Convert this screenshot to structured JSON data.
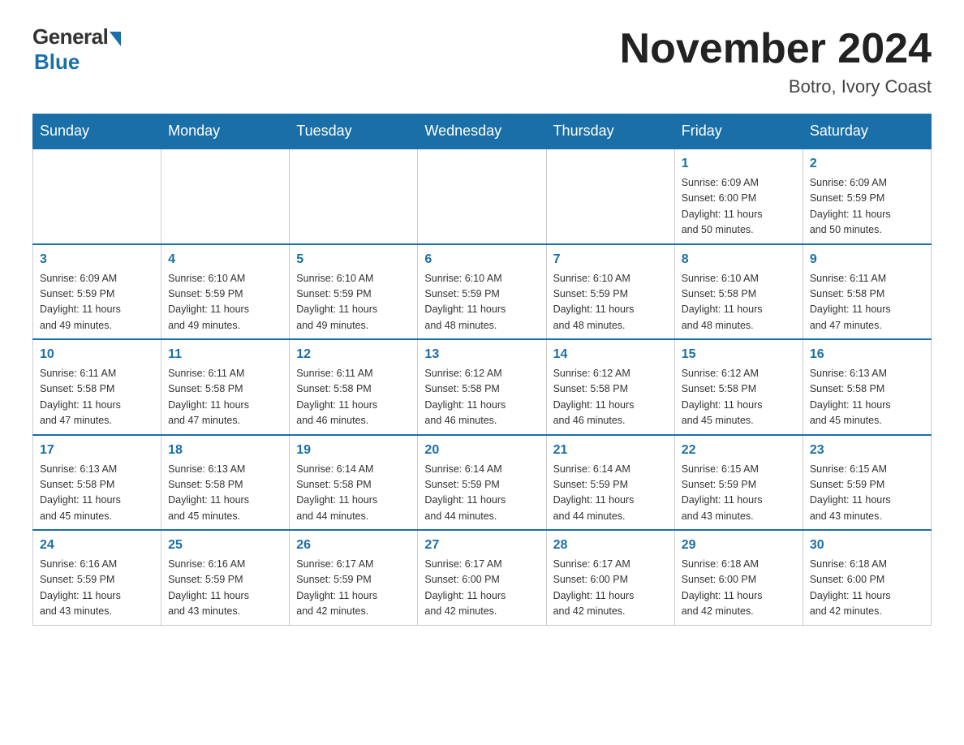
{
  "header": {
    "logo_general": "General",
    "logo_blue": "Blue",
    "month_title": "November 2024",
    "subtitle": "Botro, Ivory Coast"
  },
  "days_of_week": [
    "Sunday",
    "Monday",
    "Tuesday",
    "Wednesday",
    "Thursday",
    "Friday",
    "Saturday"
  ],
  "weeks": [
    [
      {
        "day": "",
        "info": ""
      },
      {
        "day": "",
        "info": ""
      },
      {
        "day": "",
        "info": ""
      },
      {
        "day": "",
        "info": ""
      },
      {
        "day": "",
        "info": ""
      },
      {
        "day": "1",
        "info": "Sunrise: 6:09 AM\nSunset: 6:00 PM\nDaylight: 11 hours\nand 50 minutes."
      },
      {
        "day": "2",
        "info": "Sunrise: 6:09 AM\nSunset: 5:59 PM\nDaylight: 11 hours\nand 50 minutes."
      }
    ],
    [
      {
        "day": "3",
        "info": "Sunrise: 6:09 AM\nSunset: 5:59 PM\nDaylight: 11 hours\nand 49 minutes."
      },
      {
        "day": "4",
        "info": "Sunrise: 6:10 AM\nSunset: 5:59 PM\nDaylight: 11 hours\nand 49 minutes."
      },
      {
        "day": "5",
        "info": "Sunrise: 6:10 AM\nSunset: 5:59 PM\nDaylight: 11 hours\nand 49 minutes."
      },
      {
        "day": "6",
        "info": "Sunrise: 6:10 AM\nSunset: 5:59 PM\nDaylight: 11 hours\nand 48 minutes."
      },
      {
        "day": "7",
        "info": "Sunrise: 6:10 AM\nSunset: 5:59 PM\nDaylight: 11 hours\nand 48 minutes."
      },
      {
        "day": "8",
        "info": "Sunrise: 6:10 AM\nSunset: 5:58 PM\nDaylight: 11 hours\nand 48 minutes."
      },
      {
        "day": "9",
        "info": "Sunrise: 6:11 AM\nSunset: 5:58 PM\nDaylight: 11 hours\nand 47 minutes."
      }
    ],
    [
      {
        "day": "10",
        "info": "Sunrise: 6:11 AM\nSunset: 5:58 PM\nDaylight: 11 hours\nand 47 minutes."
      },
      {
        "day": "11",
        "info": "Sunrise: 6:11 AM\nSunset: 5:58 PM\nDaylight: 11 hours\nand 47 minutes."
      },
      {
        "day": "12",
        "info": "Sunrise: 6:11 AM\nSunset: 5:58 PM\nDaylight: 11 hours\nand 46 minutes."
      },
      {
        "day": "13",
        "info": "Sunrise: 6:12 AM\nSunset: 5:58 PM\nDaylight: 11 hours\nand 46 minutes."
      },
      {
        "day": "14",
        "info": "Sunrise: 6:12 AM\nSunset: 5:58 PM\nDaylight: 11 hours\nand 46 minutes."
      },
      {
        "day": "15",
        "info": "Sunrise: 6:12 AM\nSunset: 5:58 PM\nDaylight: 11 hours\nand 45 minutes."
      },
      {
        "day": "16",
        "info": "Sunrise: 6:13 AM\nSunset: 5:58 PM\nDaylight: 11 hours\nand 45 minutes."
      }
    ],
    [
      {
        "day": "17",
        "info": "Sunrise: 6:13 AM\nSunset: 5:58 PM\nDaylight: 11 hours\nand 45 minutes."
      },
      {
        "day": "18",
        "info": "Sunrise: 6:13 AM\nSunset: 5:58 PM\nDaylight: 11 hours\nand 45 minutes."
      },
      {
        "day": "19",
        "info": "Sunrise: 6:14 AM\nSunset: 5:58 PM\nDaylight: 11 hours\nand 44 minutes."
      },
      {
        "day": "20",
        "info": "Sunrise: 6:14 AM\nSunset: 5:59 PM\nDaylight: 11 hours\nand 44 minutes."
      },
      {
        "day": "21",
        "info": "Sunrise: 6:14 AM\nSunset: 5:59 PM\nDaylight: 11 hours\nand 44 minutes."
      },
      {
        "day": "22",
        "info": "Sunrise: 6:15 AM\nSunset: 5:59 PM\nDaylight: 11 hours\nand 43 minutes."
      },
      {
        "day": "23",
        "info": "Sunrise: 6:15 AM\nSunset: 5:59 PM\nDaylight: 11 hours\nand 43 minutes."
      }
    ],
    [
      {
        "day": "24",
        "info": "Sunrise: 6:16 AM\nSunset: 5:59 PM\nDaylight: 11 hours\nand 43 minutes."
      },
      {
        "day": "25",
        "info": "Sunrise: 6:16 AM\nSunset: 5:59 PM\nDaylight: 11 hours\nand 43 minutes."
      },
      {
        "day": "26",
        "info": "Sunrise: 6:17 AM\nSunset: 5:59 PM\nDaylight: 11 hours\nand 42 minutes."
      },
      {
        "day": "27",
        "info": "Sunrise: 6:17 AM\nSunset: 6:00 PM\nDaylight: 11 hours\nand 42 minutes."
      },
      {
        "day": "28",
        "info": "Sunrise: 6:17 AM\nSunset: 6:00 PM\nDaylight: 11 hours\nand 42 minutes."
      },
      {
        "day": "29",
        "info": "Sunrise: 6:18 AM\nSunset: 6:00 PM\nDaylight: 11 hours\nand 42 minutes."
      },
      {
        "day": "30",
        "info": "Sunrise: 6:18 AM\nSunset: 6:00 PM\nDaylight: 11 hours\nand 42 minutes."
      }
    ]
  ]
}
